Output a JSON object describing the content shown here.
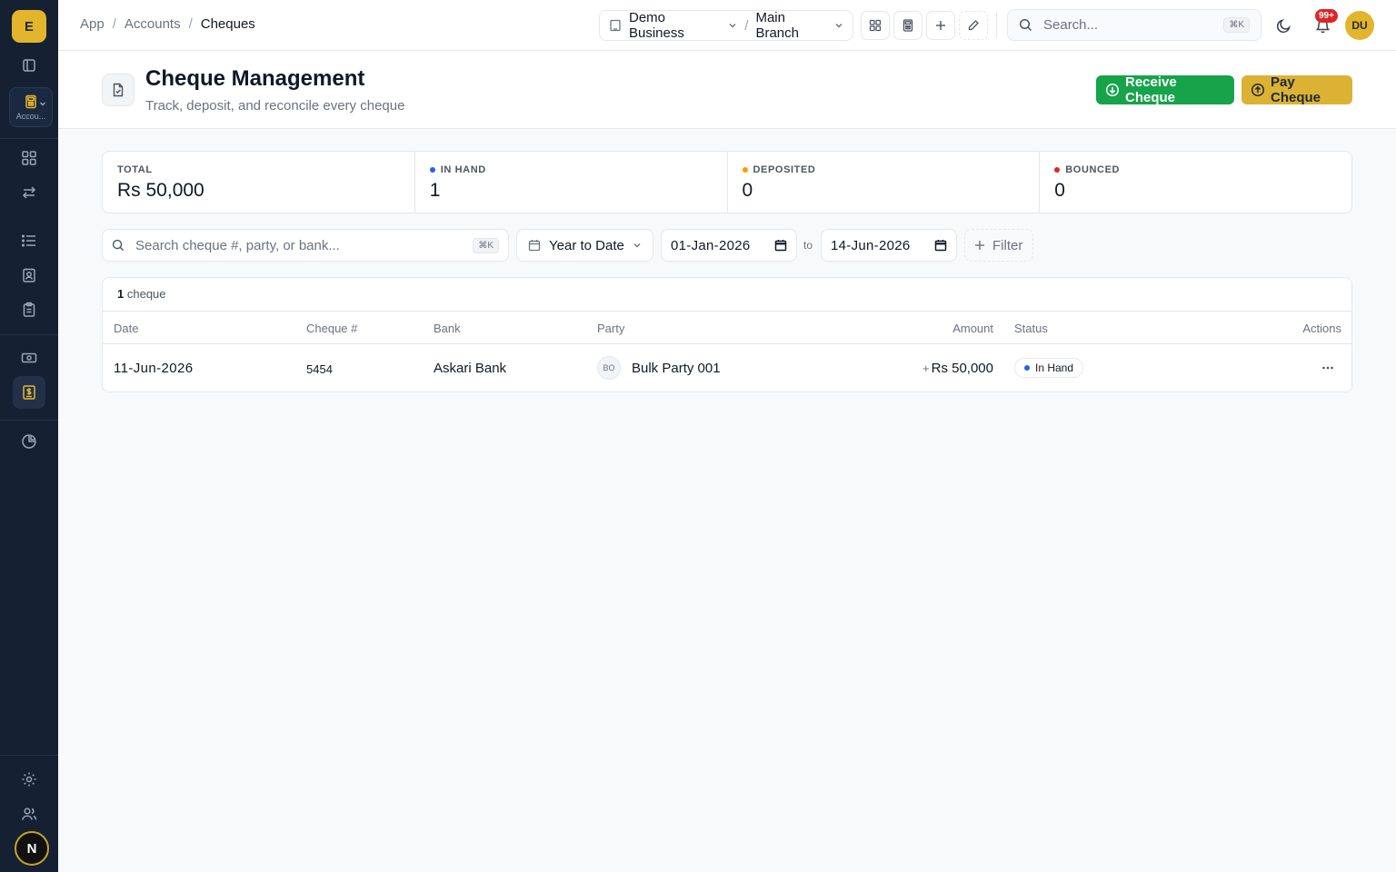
{
  "sidebar": {
    "logo_letter": "E",
    "module_label": "Accou...",
    "user_initial": "N"
  },
  "breadcrumb": {
    "items": [
      "App",
      "Accounts"
    ],
    "current": "Cheques"
  },
  "topbar": {
    "business": "Demo Business",
    "branch": "Main Branch",
    "search_placeholder": "Search...",
    "search_shortcut": "⌘K",
    "notification_count": "99+",
    "user_initials": "DU"
  },
  "page": {
    "title": "Cheque Management",
    "subtitle": "Track, deposit, and reconcile every cheque",
    "receive_label": "Receive Cheque",
    "pay_label": "Pay Cheque"
  },
  "stats": [
    {
      "label": "TOTAL",
      "value": "Rs 50,000",
      "dot_color": ""
    },
    {
      "label": "IN HAND",
      "value": "1",
      "dot_color": "#2563eb"
    },
    {
      "label": "DEPOSITED",
      "value": "0",
      "dot_color": "#f59e0b"
    },
    {
      "label": "BOUNCED",
      "value": "0",
      "dot_color": "#dc2626"
    }
  ],
  "filters": {
    "search_placeholder": "Search cheque #, party, or bank...",
    "search_shortcut": "⌘K",
    "period": "Year to Date",
    "date_from": "01-Jan-2026",
    "to_label": "to",
    "date_to": "14-Jun-2026",
    "filter_label": "Filter"
  },
  "table": {
    "count": "1",
    "count_suffix": "cheque",
    "columns": [
      "Date",
      "Cheque #",
      "Bank",
      "Party",
      "Amount",
      "Status",
      "Actions"
    ],
    "rows": [
      {
        "date": "11-Jun-2026",
        "cheque_no": "5454",
        "bank": "Askari Bank",
        "party_initials": "BO",
        "party": "Bulk Party 001",
        "amount_sign": "+",
        "amount": "Rs 50,000",
        "status": "In Hand",
        "status_color": "#2563eb"
      }
    ]
  },
  "colors": {
    "sidebar_bg": "#152033",
    "accent_gold": "#dcb234",
    "receive_green": "#16a34a"
  }
}
